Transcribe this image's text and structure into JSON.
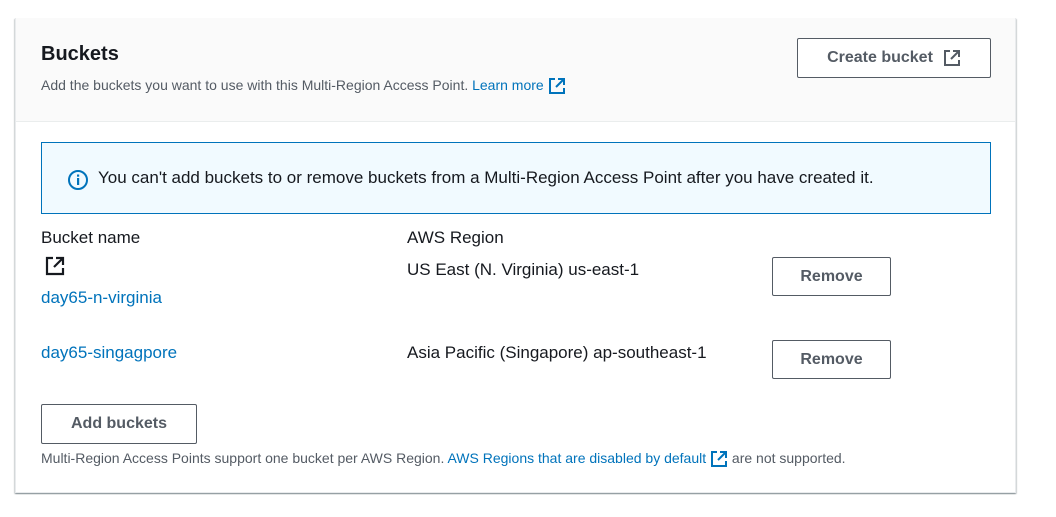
{
  "header": {
    "title": "Buckets",
    "description": "Add the buckets you want to use with this Multi-Region Access Point.",
    "learn_more": "Learn more",
    "create_button": "Create bucket"
  },
  "alert": {
    "message": "You can't add buckets to or remove buckets from a Multi-Region Access Point after you have created it."
  },
  "table": {
    "columns": [
      "Bucket name",
      "AWS Region"
    ],
    "rows": [
      {
        "bucket": "day65-n-virginia",
        "region": "US East (N. Virginia) us-east-1",
        "action": "Remove"
      },
      {
        "bucket": "day65-singagpore",
        "region": "Asia Pacific (Singapore) ap-southeast-1",
        "action": "Remove"
      }
    ]
  },
  "add_button": "Add buckets",
  "footer": {
    "prefix": "Multi-Region Access Points support one bucket per AWS Region.",
    "link": "AWS Regions that are disabled by default",
    "suffix": "are not supported."
  },
  "colors": {
    "link": "#0073bb",
    "alert_bg": "#f1faff",
    "alert_border": "#0073bb",
    "button_border": "#545b64"
  }
}
